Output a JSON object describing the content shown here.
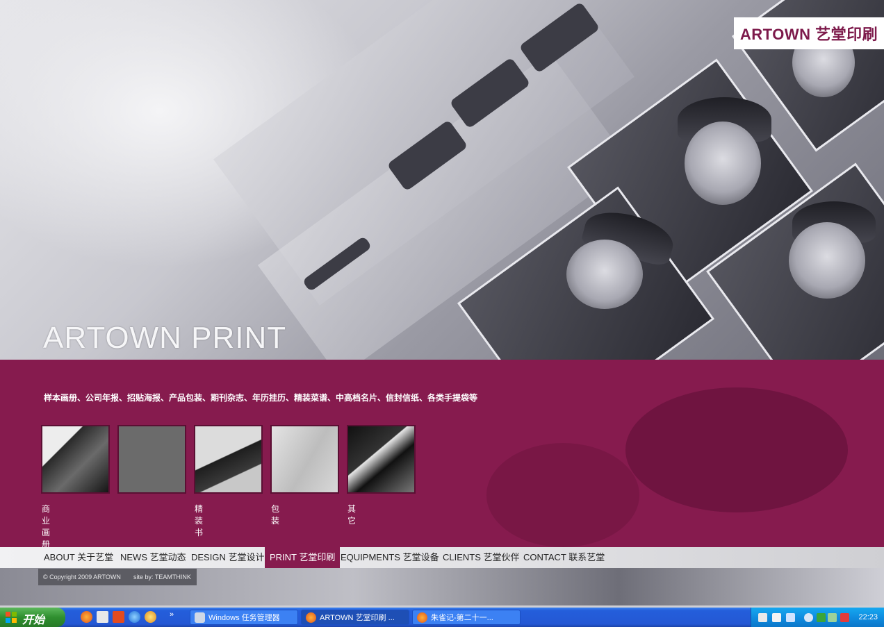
{
  "logo": {
    "text": "ARTOWN 艺堂印刷"
  },
  "hero": {
    "title": "ARTOWN PRINT"
  },
  "panel": {
    "description": "样本画册、公司年报、招贴海报、产品包装、期刊杂志、年历挂历、精装菜谱、中高档名片、信封信纸、各类手提袋等",
    "thumbnails": [
      {
        "label": "商业画册"
      },
      {
        "label": ""
      },
      {
        "label": "精装书"
      },
      {
        "label": "包装"
      },
      {
        "label": "其它"
      }
    ]
  },
  "nav": {
    "items": [
      {
        "label": "ABOUT 关于艺堂"
      },
      {
        "label": "NEWS 艺堂动态"
      },
      {
        "label": "DESIGN 艺堂设计"
      },
      {
        "label": "PRINT 艺堂印刷",
        "active": true
      },
      {
        "label": "EQUIPMENTS 艺堂设备"
      },
      {
        "label": "CLIENTS 艺堂伙伴"
      },
      {
        "label": "CONTACT 联系艺堂"
      }
    ]
  },
  "footer": {
    "copyright": "© Copyright 2009 ARTOWN",
    "site_by": "site by: TEAMTHINK"
  },
  "taskbar": {
    "start_label": "开始",
    "tasks": [
      {
        "label": "Windows 任务管理器",
        "icon": "task-manager-icon"
      },
      {
        "label": "ARTOWN 艺堂印刷 ...",
        "icon": "firefox-icon",
        "active": true
      },
      {
        "label": "朱雀记-第二十一...",
        "icon": "firefox-icon"
      }
    ],
    "clock": "22:23"
  },
  "colors": {
    "brand": "#861b4e",
    "taskbar": "#245edb",
    "start": "#2f8f2f"
  }
}
